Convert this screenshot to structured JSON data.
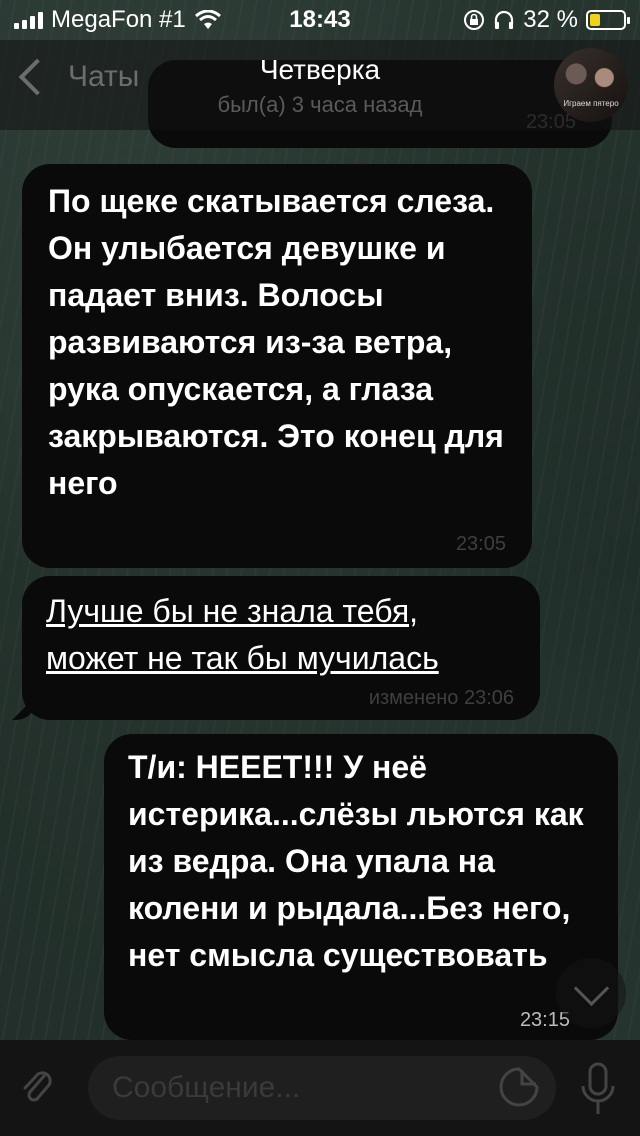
{
  "status": {
    "carrier": "MegaFon #1",
    "time": "18:43",
    "battery_percent_label": "32 %",
    "battery_level": 0.32,
    "battery_color": "#f2d11e",
    "icons": [
      "signal-icon",
      "wifi-icon",
      "rotation-lock-icon",
      "headphones-icon",
      "battery-icon"
    ]
  },
  "nav": {
    "back_label": "Чаты",
    "title": "Четверка",
    "subtitle": "был(а) 3 часа назад",
    "avatar_caption": "Играем пятеро"
  },
  "partial_message": {
    "time": "23:05"
  },
  "messages": [
    {
      "direction": "incoming",
      "text": "По щеке скатывается слеза. Он улыбается девушке и падает вниз. Волосы развиваются из-за ветра, рука опускается, а глаза закрываются. Это конец для него",
      "time": "23:05"
    },
    {
      "direction": "incoming",
      "text_line1": "Лучше бы не знала тебя,",
      "text_line2": "может не так бы мучилась",
      "time": "изменено 23:06"
    },
    {
      "direction": "outgoing",
      "text": "Т/и: НЕЕЕТ!!! У неё истерика...слёзы льются как из ведра. Она упала на колени и рыдала...Без него, нет смысла существовать",
      "time": "23:15"
    }
  ],
  "input": {
    "placeholder": "Сообщение..."
  },
  "colors": {
    "bubble": "#0a0a0a",
    "meta_text": "#3f3f3f",
    "nav_secondary": "#6d6d6d"
  }
}
